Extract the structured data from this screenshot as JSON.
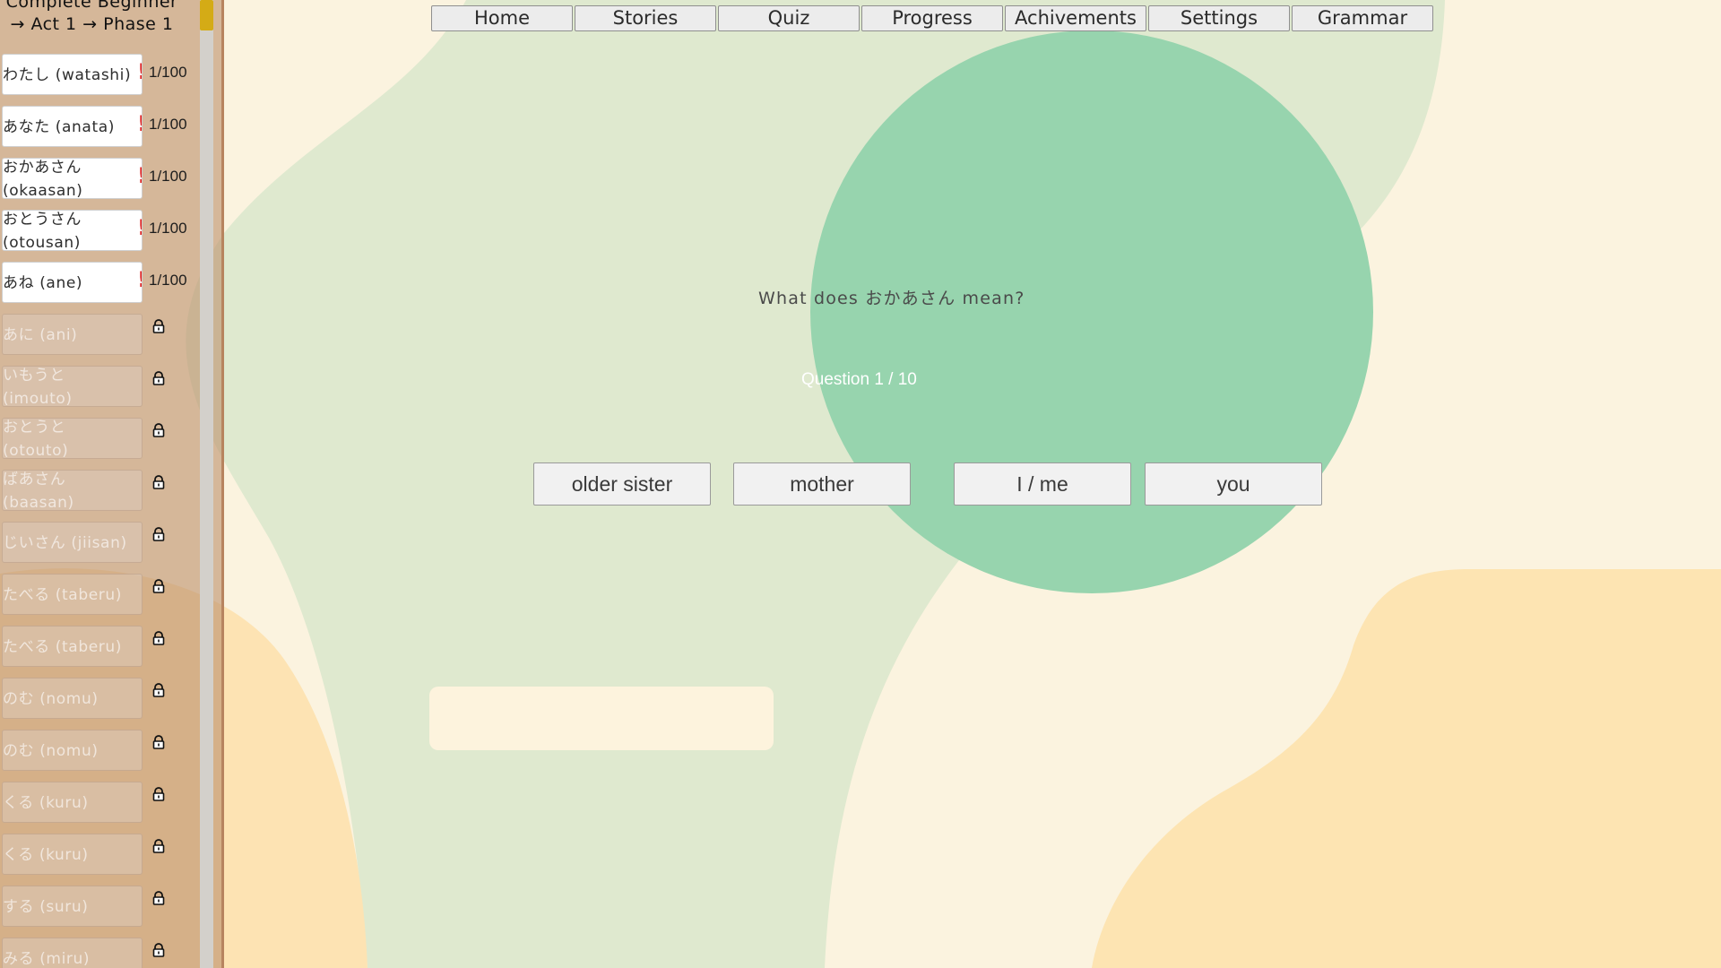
{
  "nav": {
    "items": [
      "Home",
      "Stories",
      "Quiz",
      "Progress",
      "Achivements",
      "Settings",
      "Grammar"
    ]
  },
  "sidebar": {
    "phase_title": "Complete Beginner → Act 1 → Phase 1",
    "vocab": [
      {
        "text": "わたし (watashi)",
        "locked": false,
        "progress": "1/100",
        "alert": "!"
      },
      {
        "text": "あなた (anata)",
        "locked": false,
        "progress": "1/100",
        "alert": "!"
      },
      {
        "text": "おかあさん (okaasan)",
        "locked": false,
        "progress": "1/100",
        "alert": "!"
      },
      {
        "text": "おとうさん (otousan)",
        "locked": false,
        "progress": "1/100",
        "alert": "!"
      },
      {
        "text": "あね (ane)",
        "locked": false,
        "progress": "1/100",
        "alert": "!"
      },
      {
        "text": "あに (ani)",
        "locked": true,
        "icon": "lock-icon"
      },
      {
        "text": "いもうと (imouto)",
        "locked": true,
        "icon": "lock-icon"
      },
      {
        "text": "おとうと (otouto)",
        "locked": true,
        "icon": "lock-icon"
      },
      {
        "text": "ばあさん (baasan)",
        "locked": true,
        "icon": "lock-icon"
      },
      {
        "text": "じいさん (jiisan)",
        "locked": true,
        "icon": "lock-icon"
      },
      {
        "text": "たべる (taberu)",
        "locked": true,
        "icon": "lock-icon"
      },
      {
        "text": "たべる (taberu)",
        "locked": true,
        "icon": "lock-icon"
      },
      {
        "text": "のむ (nomu)",
        "locked": true,
        "icon": "lock-icon"
      },
      {
        "text": "のむ (nomu)",
        "locked": true,
        "icon": "lock-icon"
      },
      {
        "text": "くる (kuru)",
        "locked": true,
        "icon": "lock-icon"
      },
      {
        "text": "くる (kuru)",
        "locked": true,
        "icon": "lock-icon"
      },
      {
        "text": "する (suru)",
        "locked": true,
        "icon": "lock-icon"
      },
      {
        "text": "みる (miru)",
        "locked": true,
        "icon": "lock-icon"
      }
    ]
  },
  "quiz": {
    "question": "What does おかあさん mean?",
    "counter": "Question 1 / 10",
    "answers": [
      "older sister",
      "mother",
      "I / me",
      "you"
    ],
    "answer_input_value": ""
  },
  "colors": {
    "accent_circle": "#97d4ae",
    "scroll_thumb": "#d4ab16",
    "alert": "#e01b1b"
  }
}
